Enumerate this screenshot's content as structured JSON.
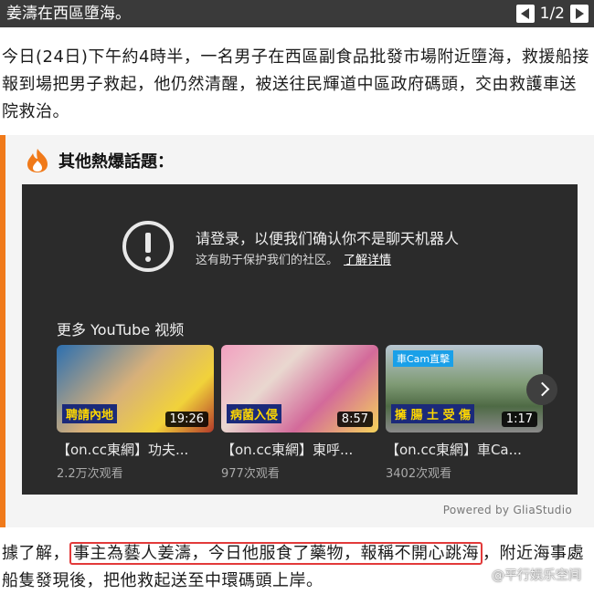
{
  "header": {
    "title": "姜濤在西區墮海。",
    "pager": "1/2"
  },
  "article": {
    "paragraph1": "今日(24日)下午約4時半，一名男子在西區副食品批發市場附近墮海，救援船接報到場把男子救起，他仍然清醒，被送往民輝道中區政府碼頭，交由救護車送院救治。",
    "paragraph2_before": "據了解，",
    "paragraph2_highlight": "事主為藝人姜濤，今日他服食了藥物，報稱不開心跳海",
    "paragraph2_after": "，附近海事處船隻發現後，把他救起送至中環碼頭上岸。"
  },
  "related": {
    "title": "其他熱爆話題：",
    "accent": "#f07a1a",
    "embed": {
      "signin_message": "请登录，以便我们确认你不是聊天机器人",
      "signin_sub": "这有助于保护我们的社区。",
      "learn_more": "了解详情",
      "more_videos": "更多 YouTube 视频",
      "videos": [
        {
          "title": "【on.cc東網】功夫...",
          "views": "2.2万次观看",
          "duration": "19:26",
          "caption": "聘請內地",
          "badge": ""
        },
        {
          "title": "【on.cc東網】東呼...",
          "views": "977次观看",
          "duration": "8:57",
          "caption": "病菌入侵",
          "badge": ""
        },
        {
          "title": "【on.cc東網】車Ca...",
          "views": "3402次观看",
          "duration": "1:17",
          "caption": "擁 腸 土 受 傷",
          "badge": "車Cam直擊"
        }
      ],
      "powered_by": "Powered by GliaStudio"
    }
  },
  "watermark": "@平行娱乐空间"
}
